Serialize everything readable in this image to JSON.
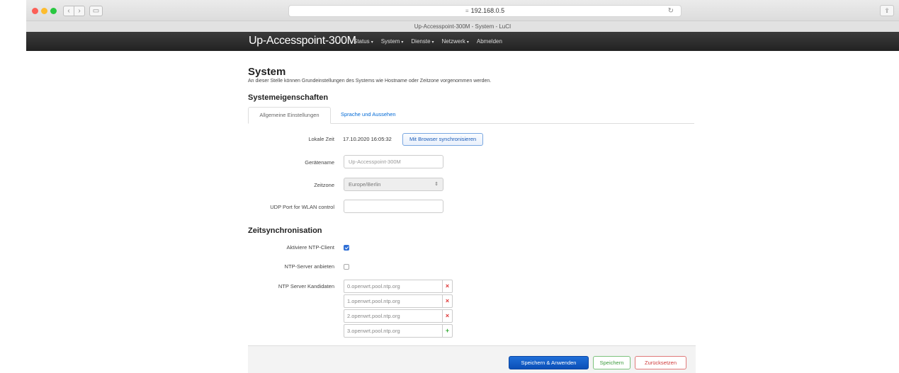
{
  "browser": {
    "url": "192.168.0.5",
    "tab_title": "Up-Accesspoint-300M - System - LuCI",
    "back_glyph": "‹",
    "forward_glyph": "›",
    "sidebar_glyph": "▭",
    "reload_glyph": "↻",
    "share_glyph": "⇪",
    "lock_glyph": "≡"
  },
  "header": {
    "brand": "Up-Accesspoint-300M",
    "menu": [
      {
        "label": "Status",
        "caret": "▾"
      },
      {
        "label": "System",
        "caret": "▾"
      },
      {
        "label": "Dienste",
        "caret": "▾"
      },
      {
        "label": "Netzwerk",
        "caret": "▾"
      },
      {
        "label": "Abmelden",
        "caret": ""
      }
    ]
  },
  "page": {
    "title": "System",
    "description": "An dieser Stelle können Grundeinstellungen des Systems wie Hostname oder Zeitzone vorgenommen werden."
  },
  "properties": {
    "section_title": "Systemeigenschaften",
    "tabs": [
      {
        "label": "Allgemeine Einstellungen",
        "active": true
      },
      {
        "label": "Sprache und Aussehen",
        "active": false
      }
    ],
    "local_time_label": "Lokale Zeit",
    "local_time_value": "17.10.2020 16:05:32",
    "sync_button": "Mit Browser synchronisieren",
    "hostname_label": "Gerätename",
    "hostname_placeholder": "Up-Accesspoint-300M",
    "timezone_label": "Zeitzone",
    "timezone_value": "Europe/Berlin",
    "timezone_arrows": "⇕",
    "udp_label": "UDP Port for WLAN control",
    "udp_value": ""
  },
  "timesync": {
    "section_title": "Zeitsynchronisation",
    "ntp_client_label": "Aktiviere NTP-Client",
    "ntp_client_checked": true,
    "ntp_server_label": "NTP-Server anbieten",
    "ntp_server_checked": false,
    "candidates_label": "NTP Server Kandidaten",
    "candidates": [
      {
        "host": "0.openwrt.pool.ntp.org",
        "action": "×"
      },
      {
        "host": "1.openwrt.pool.ntp.org",
        "action": "×"
      },
      {
        "host": "2.openwrt.pool.ntp.org",
        "action": "×"
      },
      {
        "host": "3.openwrt.pool.ntp.org",
        "action": "+"
      }
    ]
  },
  "actions": {
    "save_apply": "Speichern & Anwenden",
    "save": "Speichern",
    "reset": "Zurücksetzen"
  },
  "colors": {
    "header_bg": "#2a2a2a",
    "link": "#0069d6",
    "primary": "#0b4fb7",
    "success": "#3c9b3c",
    "danger": "#cf3a3a"
  }
}
